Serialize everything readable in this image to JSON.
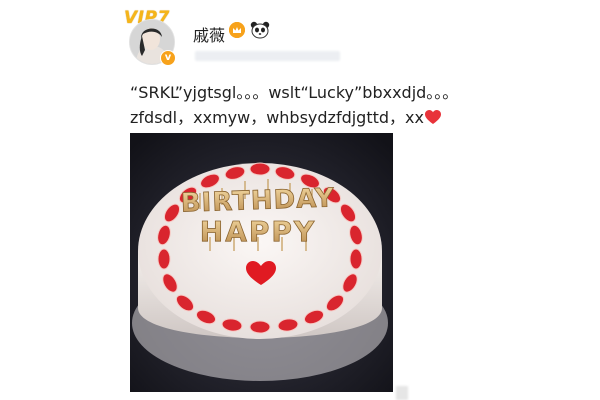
{
  "header": {
    "vip_label": "VIP7",
    "username": "戚薇",
    "icons": [
      "vip-icon",
      "verified-icon",
      "crown-icon",
      "panda-icon"
    ]
  },
  "post": {
    "line1": "“SRKL”yjgtsgl。。。wslt“Lucky”bbxxdjd。。。",
    "line2": "zfdsdl，xxmyw，whbsydzfdjgttd，xx",
    "emoji": "heart-icon"
  },
  "photo": {
    "topper_word1": "BIRTHDAY",
    "topper_word2": "HAPPY"
  },
  "colors": {
    "vip_gold": "#f5b51a",
    "badge_orange": "#f7a21b",
    "heart_red": "#e8333a",
    "strawberry_red": "#d9252e"
  }
}
